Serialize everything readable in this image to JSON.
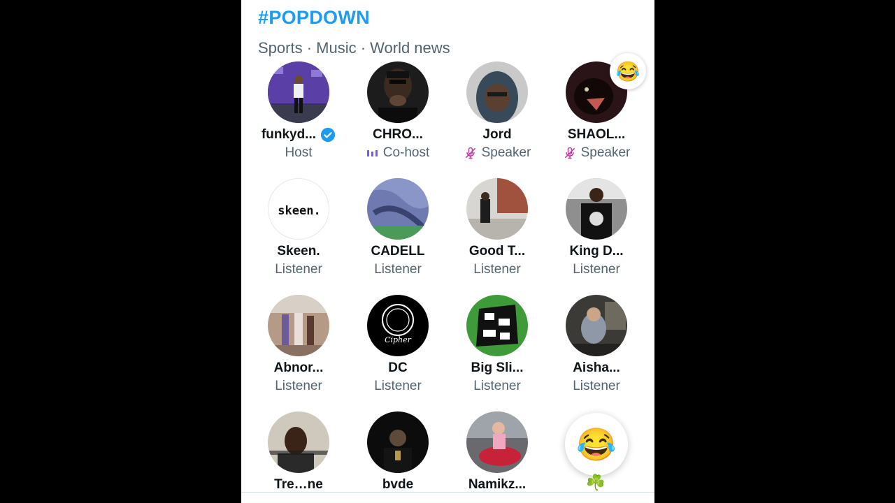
{
  "header": {
    "hashtag": "#POPDOWN",
    "topics": "Sports · Music · World news"
  },
  "participants": [
    {
      "name": "funkyd...",
      "role": "Host",
      "verified": true
    },
    {
      "name": "CHRO...",
      "role": "Co-host",
      "role_icon": "speaking-bars-icon"
    },
    {
      "name": "Jord",
      "role": "Speaker",
      "role_icon": "mic-off-icon"
    },
    {
      "name": "SHAOL...",
      "role": "Speaker",
      "role_icon": "mic-off-icon",
      "reaction": "😂"
    },
    {
      "name": "Skeen.",
      "role": "Listener",
      "avatar_text": "skeen."
    },
    {
      "name": "CADELL",
      "role": "Listener"
    },
    {
      "name": "Good T...",
      "role": "Listener"
    },
    {
      "name": "King D...",
      "role": "Listener"
    },
    {
      "name": "Abnor...",
      "role": "Listener"
    },
    {
      "name": "DC",
      "role": "Listener",
      "avatar_text": "Cipher"
    },
    {
      "name": "Big Sli...",
      "role": "Listener"
    },
    {
      "name": "Aisha...",
      "role": "Listener"
    },
    {
      "name": "Tre…ne",
      "role": ""
    },
    {
      "name": "bvde",
      "role": ""
    },
    {
      "name": "Namikz...",
      "role": ""
    }
  ],
  "reactions": {
    "floating": "😂",
    "clover": "☘️"
  },
  "colors": {
    "accent": "#1d9bf0",
    "muted_text": "#536471",
    "speaker_purple": "#7856ff"
  }
}
